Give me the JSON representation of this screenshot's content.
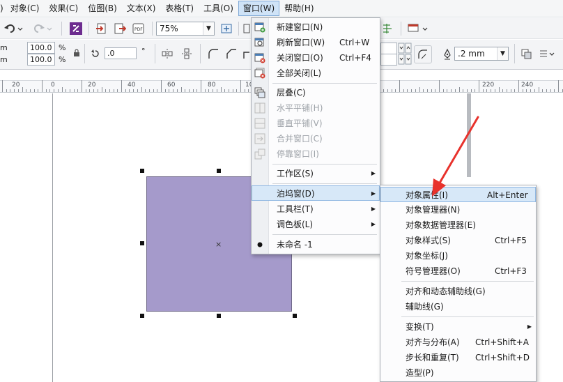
{
  "menubar": {
    "items": [
      ")",
      "对象(C)",
      "效果(C)",
      "位图(B)",
      "文本(X)",
      "表格(T)",
      "工具(O)",
      "窗口(W)",
      "帮助(H)"
    ]
  },
  "toolbar": {
    "zoom_value": "75%",
    "size_w_unit": "m",
    "size_h_unit": "m",
    "scale_x": "100.0",
    "scale_y": "100.0",
    "pct_x": "%",
    "pct_y": "%",
    "rotation": ".0",
    "degree": "°",
    "outline_width": ".2 mm"
  },
  "ruler": {
    "labels": [
      "20",
      "0",
      "20",
      "40",
      "60",
      "80",
      "10",
      "220",
      "240"
    ]
  },
  "window_menu": {
    "items": [
      {
        "label": "新建窗口(N)",
        "shortcut": "",
        "icon": "new-window-icon",
        "disabled": false
      },
      {
        "label": "刷新窗口(W)",
        "shortcut": "Ctrl+W",
        "icon": "refresh-window-icon",
        "disabled": false
      },
      {
        "label": "关闭窗口(O)",
        "shortcut": "Ctrl+F4",
        "icon": "close-window-icon",
        "disabled": false
      },
      {
        "label": "全部关闭(L)",
        "shortcut": "",
        "icon": "close-all-icon",
        "disabled": false
      },
      {
        "label": "层叠(C)",
        "shortcut": "",
        "icon": "cascade-icon",
        "disabled": false
      },
      {
        "label": "水平平铺(H)",
        "shortcut": "",
        "icon": "tile-horizontal-icon",
        "disabled": true
      },
      {
        "label": "垂直平铺(V)",
        "shortcut": "",
        "icon": "tile-vertical-icon",
        "disabled": true
      },
      {
        "label": "合并窗口(C)",
        "shortcut": "",
        "icon": "combine-windows-icon",
        "disabled": true
      },
      {
        "label": "停靠窗口(I)",
        "shortcut": "",
        "icon": "dock-windows-icon",
        "disabled": true
      },
      {
        "label": "工作区(S)",
        "shortcut": "",
        "icon": "",
        "disabled": false
      },
      {
        "label": "泊坞窗(D)",
        "shortcut": "",
        "icon": "",
        "disabled": false
      },
      {
        "label": "工具栏(T)",
        "shortcut": "",
        "icon": "",
        "disabled": false
      },
      {
        "label": "调色板(L)",
        "shortcut": "",
        "icon": "",
        "disabled": false
      },
      {
        "label": "未命名 -1",
        "shortcut": "",
        "icon": "bullet-icon",
        "disabled": false
      }
    ]
  },
  "docker_submenu": {
    "items": [
      {
        "label": "对象属性(I)",
        "shortcut": "Alt+Enter"
      },
      {
        "label": "对象管理器(N)",
        "shortcut": ""
      },
      {
        "label": "对象数据管理器(E)",
        "shortcut": ""
      },
      {
        "label": "对象样式(S)",
        "shortcut": "Ctrl+F5"
      },
      {
        "label": "对象坐标(J)",
        "shortcut": ""
      },
      {
        "label": "符号管理器(O)",
        "shortcut": "Ctrl+F3"
      },
      {
        "label": "对齐和动态辅助线(G)",
        "shortcut": ""
      },
      {
        "label": "辅助线(G)",
        "shortcut": ""
      },
      {
        "label": "变换(T)",
        "shortcut": ""
      },
      {
        "label": "对齐与分布(A)",
        "shortcut": "Ctrl+Shift+A"
      },
      {
        "label": "步长和重复(T)",
        "shortcut": "Ctrl+Shift+D"
      },
      {
        "label": "造型(P)",
        "shortcut": ""
      }
    ]
  },
  "colors": {
    "shape_fill": "#a59acb",
    "annotation_arrow": "#e8322c",
    "menu_highlight": "#d7e8f8"
  }
}
